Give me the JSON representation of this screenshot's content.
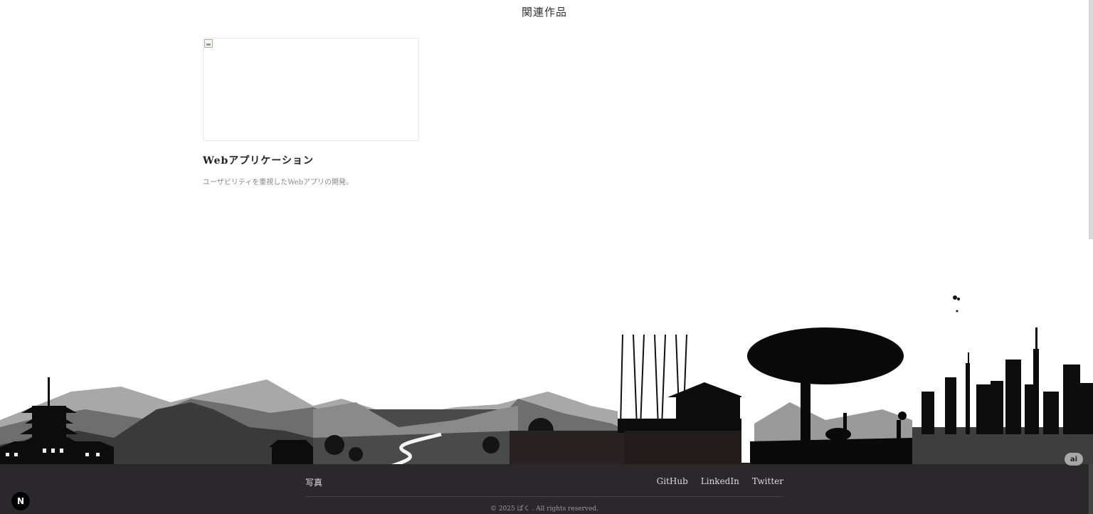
{
  "section": {
    "title": "関連作品"
  },
  "related_works": [
    {
      "title": "Webアプリケーション",
      "description": "ユーザビリティを重視したWebアプリの開発。"
    }
  ],
  "footer": {
    "left_link": "写真",
    "links": [
      "GitHub",
      "LinkedIn",
      "Twitter"
    ],
    "copyright": "© 2025 ぱく . All rights reserved."
  },
  "badges": {
    "next": "N",
    "ai": "ai"
  },
  "colors": {
    "footer_bg": "#2a282b",
    "silhouette": "#111111",
    "mountain_light": "#9a9a9a"
  }
}
